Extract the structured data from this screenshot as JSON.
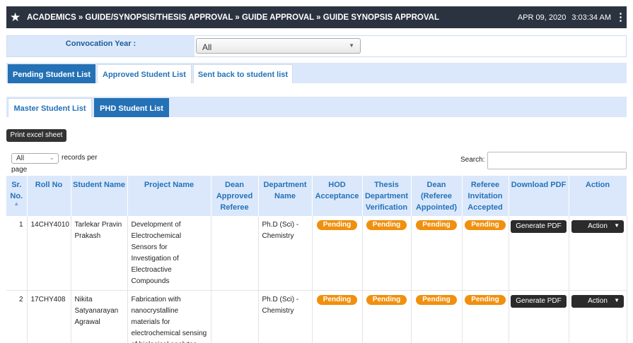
{
  "header": {
    "breadcrumb": "ACADEMICS » GUIDE/SYNOPSIS/THESIS APPROVAL » GUIDE APPROVAL » GUIDE SYNOPSIS APPROVAL",
    "date": "APR 09, 2020",
    "time": "3:03:34 AM"
  },
  "filter": {
    "convocation_label": "Convocation Year :",
    "convocation_value": "All"
  },
  "tabs_primary": [
    {
      "label": "Pending Student List",
      "active": true
    },
    {
      "label": "Approved Student List",
      "active": false
    },
    {
      "label": "Sent back to student list",
      "active": false
    }
  ],
  "tabs_secondary": [
    {
      "label": "Master Student List",
      "active": false
    },
    {
      "label": "PHD Student List",
      "active": true
    }
  ],
  "toolbar": {
    "print_label": "Print excel sheet",
    "page_length_value": "All",
    "records_text_1": "records per",
    "records_text_2": "page",
    "search_label": "Search:"
  },
  "table": {
    "columns": [
      "Sr. No.",
      "Roll No",
      "Student Name",
      "Project Name",
      "Dean Approved Referee",
      "Department Name",
      "HOD Acceptance",
      "Thesis Department Verification",
      "Dean (Referee Appointed)",
      "Referee Invitation Accepted",
      "Download PDF",
      "Action"
    ],
    "rows": [
      {
        "sr": "1",
        "roll": "14CHY4010",
        "name": "Tarlekar Pravin Prakash",
        "project": "Development of Electrochemical Sensors for Investigation of Electroactive Compounds",
        "dean_referee": "",
        "department": "Ph.D (Sci) - Chemistry",
        "hod": "Pending",
        "thesis": "Pending",
        "dean_appointed": "Pending",
        "referee_accepted": "Pending",
        "pdf_label": "Generate PDF",
        "action_label": "Action"
      },
      {
        "sr": "2",
        "roll": "17CHY408",
        "name": "Nikita Satyanarayan Agrawal",
        "project": "Fabrication with nanocrystalline materials for electrochemical sensing of biological analytes.",
        "dean_referee": "",
        "department": "Ph.D (Sci) - Chemistry",
        "hod": "Pending",
        "thesis": "Pending",
        "dean_appointed": "Pending",
        "referee_accepted": "Pending",
        "pdf_label": "Generate PDF",
        "action_label": "Action"
      }
    ]
  }
}
